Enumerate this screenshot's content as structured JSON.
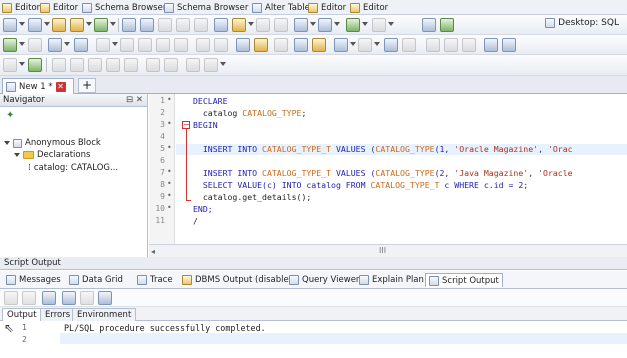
{
  "tabs": [
    {
      "label": "Editor",
      "icon": "editor-icon"
    },
    {
      "label": "Editor",
      "icon": "editor-icon"
    },
    {
      "label": "Schema Browser",
      "icon": "schema-browser-icon"
    },
    {
      "label": "Schema Browser",
      "icon": "schema-browser-icon"
    },
    {
      "label": "Alter Table",
      "icon": "alter-table-icon"
    },
    {
      "label": "Editor",
      "icon": "editor-icon"
    },
    {
      "label": "Editor",
      "icon": "editor-icon"
    }
  ],
  "toolbar": {
    "desktop_label": "Desktop: SQL"
  },
  "document_tab": {
    "label": "New 1 *",
    "close": "✕",
    "add": "+"
  },
  "navigator": {
    "title": "Navigator",
    "controls": "⊟ ✕",
    "tree": {
      "root": "Anonymous Block",
      "folder": "Declarations",
      "leaf": "catalog: CATALOG..."
    }
  },
  "editor": {
    "lines": [
      {
        "n": "1",
        "text": "DECLARE"
      },
      {
        "n": "2",
        "text": "  catalog CATALOG_TYPE;"
      },
      {
        "n": "3",
        "text": "BEGIN"
      },
      {
        "n": "4",
        "text": ""
      },
      {
        "n": "5",
        "text": "  INSERT INTO CATALOG_TYPE_T VALUES (CATALOG_TYPE(1, 'Oracle Magazine', 'Orac"
      },
      {
        "n": "6",
        "text": ""
      },
      {
        "n": "7",
        "text": "  INSERT INTO CATALOG_TYPE_T VALUES (CATALOG_TYPE(2, 'Java Magazine', 'Oracle"
      },
      {
        "n": "8",
        "text": "  SELECT VALUE(c) INTO catalog FROM CATALOG_TYPE_T c WHERE c.id = 2;"
      },
      {
        "n": "9",
        "text": "  catalog.get_details();"
      },
      {
        "n": "10",
        "text": "END;"
      },
      {
        "n": "11",
        "text": "/"
      }
    ],
    "scroll_grip": "III"
  },
  "output_panel": {
    "title": "Script Output",
    "tabs": [
      {
        "label": "Messages"
      },
      {
        "label": "Data Grid"
      },
      {
        "label": "Trace"
      },
      {
        "label": "DBMS Output (disabled)"
      },
      {
        "label": "Query Viewer"
      },
      {
        "label": "Explain Plan"
      },
      {
        "label": "Script Output"
      }
    ],
    "subtabs": [
      {
        "label": "Output"
      },
      {
        "label": "Errors"
      },
      {
        "label": "Environment"
      }
    ],
    "lines": [
      {
        "n": "1",
        "text": "PL/SQL procedure successfully completed."
      },
      {
        "n": "2",
        "text": ""
      }
    ]
  }
}
